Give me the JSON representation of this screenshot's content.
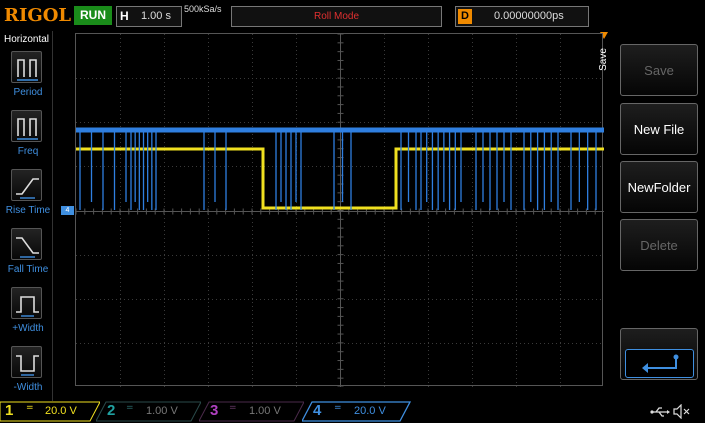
{
  "header": {
    "logo": "RIGOL",
    "run_status": "RUN",
    "timebase_label": "H",
    "timebase_value": "1.00 s",
    "sample_rate": "500kSa/s",
    "mode": "Roll Mode",
    "delay_label": "D",
    "delay_value": "0.00000000ps"
  },
  "left_menu": {
    "title": "Horizontal",
    "items": [
      {
        "label": "Period",
        "icon": "period-icon"
      },
      {
        "label": "Freq",
        "icon": "frequency-icon"
      },
      {
        "label": "Rise Time",
        "icon": "rise-time-icon"
      },
      {
        "label": "Fall Time",
        "icon": "fall-time-icon"
      },
      {
        "label": "+Width",
        "icon": "positive-width-icon"
      },
      {
        "label": "-Width",
        "icon": "negative-width-icon"
      }
    ]
  },
  "right_menu": {
    "tab_label": "Save",
    "keys": [
      {
        "label": "Save",
        "enabled": false
      },
      {
        "label": "New File",
        "enabled": true
      },
      {
        "label": "NewFolder",
        "enabled": true
      },
      {
        "label": "Delete",
        "enabled": false
      }
    ],
    "enter_icon": "enter-arrow-icon"
  },
  "channels": [
    {
      "number": "1",
      "coupling": "=",
      "scale": "20.0 V",
      "color": "#f0e020",
      "active": true
    },
    {
      "number": "2",
      "coupling": "=",
      "scale": "1.00 V",
      "color": "#20a0a0",
      "active": false
    },
    {
      "number": "3",
      "coupling": "=",
      "scale": "1.00 V",
      "color": "#b040c0",
      "active": false
    },
    {
      "number": "4",
      "coupling": "=",
      "scale": "20.0 V",
      "color": "#3f8fe0",
      "active": true
    }
  ],
  "channel4_marker": "4",
  "status_icons": [
    "usb-icon",
    "speaker-muted-icon"
  ],
  "colors": {
    "ch1": "#f0e020",
    "ch4": "#2f7fe0",
    "accent": "#f08a00",
    "run": "#1a8c1a",
    "mode_text": "#e03030"
  }
}
